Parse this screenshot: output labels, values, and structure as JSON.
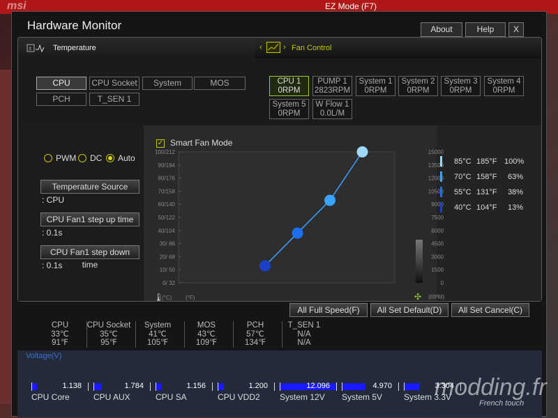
{
  "app": {
    "title": "Hardware Monitor",
    "mode_label": "EZ Mode (F7)"
  },
  "topbar": {
    "about": "About",
    "help": "Help",
    "close": "X"
  },
  "tabs": {
    "temperature": "Temperature",
    "fan_control": "Fan Control"
  },
  "sensors": [
    {
      "label": "CPU",
      "active": true
    },
    {
      "label": "CPU Socket"
    },
    {
      "label": "System"
    },
    {
      "label": "MOS"
    },
    {
      "label": "PCH"
    },
    {
      "label": "T_SEN 1"
    }
  ],
  "fans": [
    {
      "name": "CPU 1",
      "value": "0RPM",
      "active": true
    },
    {
      "name": "PUMP 1",
      "value": "2823RPM"
    },
    {
      "name": "System 1",
      "value": "0RPM"
    },
    {
      "name": "System 2",
      "value": "0RPM"
    },
    {
      "name": "System 3",
      "value": "0RPM"
    },
    {
      "name": "System 4",
      "value": "0RPM"
    },
    {
      "name": "System 5",
      "value": "0RPM"
    },
    {
      "name": "W Flow 1",
      "value": "0.0L/M"
    }
  ],
  "fan_mode": {
    "pwm": "PWM",
    "dc": "DC",
    "auto": "Auto",
    "selected": "auto"
  },
  "settings": {
    "temp_source": "Temperature Source",
    "temp_source_val": ": CPU",
    "step_up": "CPU Fan1 step up time",
    "step_up_val": ": 0.1s",
    "step_down": "CPU Fan1 step down time",
    "step_down_val": ": 0.1s"
  },
  "smart_fan": "Smart Fan Mode",
  "chart_data": {
    "type": "line",
    "y_left_ticks": [
      "100/212",
      "90/194",
      "80/176",
      "70/158",
      "60/140",
      "50/122",
      "40/104",
      "30/ 86",
      "20/ 68",
      "10/ 50",
      "0/ 32"
    ],
    "y_right_ticks": [
      "15000",
      "13500",
      "12000",
      "10500",
      "9000",
      "7500",
      "6000",
      "4500",
      "3000",
      "1500",
      "0"
    ],
    "xlabel_temp": "(°C)",
    "xlabel_temp_f": "(°F)",
    "ylabel_right": "(RPM)",
    "points": [
      {
        "temp_c": 40,
        "percent": 13
      },
      {
        "temp_c": 55,
        "percent": 38
      },
      {
        "temp_c": 70,
        "percent": 63
      },
      {
        "temp_c": 85,
        "percent": 100
      }
    ],
    "legend": [
      {
        "c": "85°C",
        "f": "185°F",
        "p": "100%",
        "color": "#9fd8ff"
      },
      {
        "c": "70°C",
        "f": "158°F",
        "p": "63%",
        "color": "#3aa2ff"
      },
      {
        "c": "55°C",
        "f": "131°F",
        "p": "38%",
        "color": "#1e6ff0"
      },
      {
        "c": "40°C",
        "f": "104°F",
        "p": "13%",
        "color": "#1a3fc8"
      }
    ]
  },
  "actions": {
    "full_speed": "All Full Speed(F)",
    "set_default": "All Set Default(D)",
    "set_cancel": "All Set Cancel(C)"
  },
  "temps": [
    {
      "name": "CPU",
      "c": "33℃",
      "f": "91℉"
    },
    {
      "name": "CPU Socket",
      "c": "35℃",
      "f": "95℉"
    },
    {
      "name": "System",
      "c": "41℃",
      "f": "105℉"
    },
    {
      "name": "MOS",
      "c": "43℃",
      "f": "109℉"
    },
    {
      "name": "PCH",
      "c": "57℃",
      "f": "134℉"
    },
    {
      "name": "T_SEN 1",
      "c": "N/A",
      "f": "N/A"
    }
  ],
  "voltage_label": "Voltage(V)",
  "voltages": [
    {
      "name": "CPU Core",
      "value": "1.138",
      "level": 0.09
    },
    {
      "name": "CPU AUX",
      "value": "1.784",
      "level": 0.14
    },
    {
      "name": "CPU SA",
      "value": "1.156",
      "level": 0.09
    },
    {
      "name": "CPU VDD2",
      "value": "1.200",
      "level": 0.1
    },
    {
      "name": "System 12V",
      "value": "12.096",
      "level": 1.0
    },
    {
      "name": "System 5V",
      "value": "4.970",
      "level": 0.41
    },
    {
      "name": "System 3.3V",
      "value": "3.304",
      "level": 0.28
    }
  ],
  "watermark": "modding.fr",
  "watermark_sub": "French touch"
}
